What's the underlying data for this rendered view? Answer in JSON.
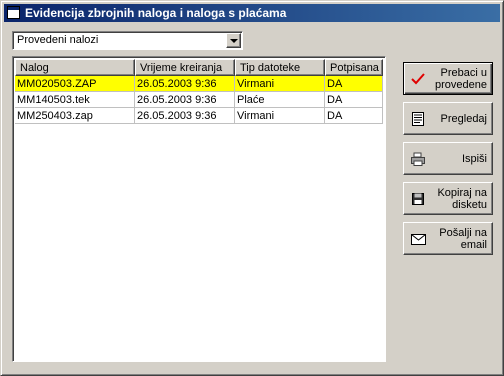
{
  "window": {
    "title": "Evidencija zbrojnih naloga i naloga  s plaćama"
  },
  "filter": {
    "selected": "Provedeni nalozi"
  },
  "table": {
    "columns": [
      "Nalog",
      "Vrijeme kreiranja",
      "Tip datoteke",
      "Potpisana"
    ],
    "rows": [
      {
        "nalog": "MM020503.ZAP",
        "vrijeme": "26.05.2003 9:36",
        "tip": "Virmani",
        "potpisana": "DA",
        "selected": true
      },
      {
        "nalog": "MM140503.tek",
        "vrijeme": "26.05.2003 9:36",
        "tip": "Plaće",
        "potpisana": "DA",
        "selected": false
      },
      {
        "nalog": "MM250403.zap",
        "vrijeme": "26.05.2003 9:36",
        "tip": "Virmani",
        "potpisana": "DA",
        "selected": false
      }
    ],
    "selected_color": "#ffff00"
  },
  "buttons": [
    {
      "id": "prebaci",
      "label": "Prebaci u\nprovedene",
      "icon": "checkmark-icon"
    },
    {
      "id": "pregledaj",
      "label": "Pregledaj",
      "icon": "document-icon"
    },
    {
      "id": "ispisi",
      "label": "Ispiši",
      "icon": "printer-icon"
    },
    {
      "id": "kopiraj",
      "label": "Kopiraj na\ndisketu",
      "icon": "floppy-disk-icon"
    },
    {
      "id": "posalji",
      "label": "Pošalji na\nemail",
      "icon": "envelope-icon"
    }
  ],
  "colors": {
    "titlebar_start": "#0a246a",
    "titlebar_end": "#3a6ea5",
    "face": "#d4d0c8",
    "checkmark": "#e00000"
  }
}
